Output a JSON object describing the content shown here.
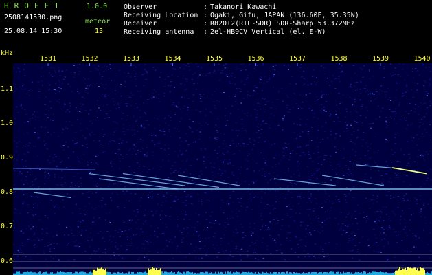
{
  "header": {
    "app_title": "HROFFT",
    "version": "1.0.0",
    "filename": "2508141530.png",
    "meteor_label": "meteor",
    "datetime": "25.08.14 15:30",
    "meteor_count": "13"
  },
  "info": [
    {
      "key": "Observer",
      "value": "Takanori Kawachi"
    },
    {
      "key": "Receiving Location",
      "value": "Ogaki, Gifu, JAPAN (136.60E, 35.35N)"
    },
    {
      "key": "Receiver",
      "value": "R820T2(RTL-SDR) SDR-Sharp 53.372MHz"
    },
    {
      "key": "Receiving antenna",
      "value": "2el-HB9CV Vertical (el. E-W)"
    }
  ],
  "info_separator": ":",
  "axis": {
    "unit_label": "kHz",
    "time_ticks": [
      "1531",
      "1532",
      "1533",
      "1534",
      "1535",
      "1536",
      "1537",
      "1538",
      "1539",
      "1540"
    ],
    "freq_ticks": [
      "1.1",
      "1.0",
      "0.9",
      "0.8",
      "0.7",
      "0.6"
    ],
    "freq_values": [
      1.1,
      1.0,
      0.9,
      0.8,
      0.7,
      0.6
    ],
    "time_values": [
      1531,
      1532,
      1533,
      1534,
      1535,
      1536,
      1537,
      1538,
      1539,
      1540
    ]
  },
  "colors": {
    "background": "#000000",
    "noise_bg": "#00003e",
    "label_green": "#8fe05a",
    "label_yellow": "#ffff33",
    "signal": "#9fe8ff",
    "bright_signal": "#f0ff80"
  }
}
